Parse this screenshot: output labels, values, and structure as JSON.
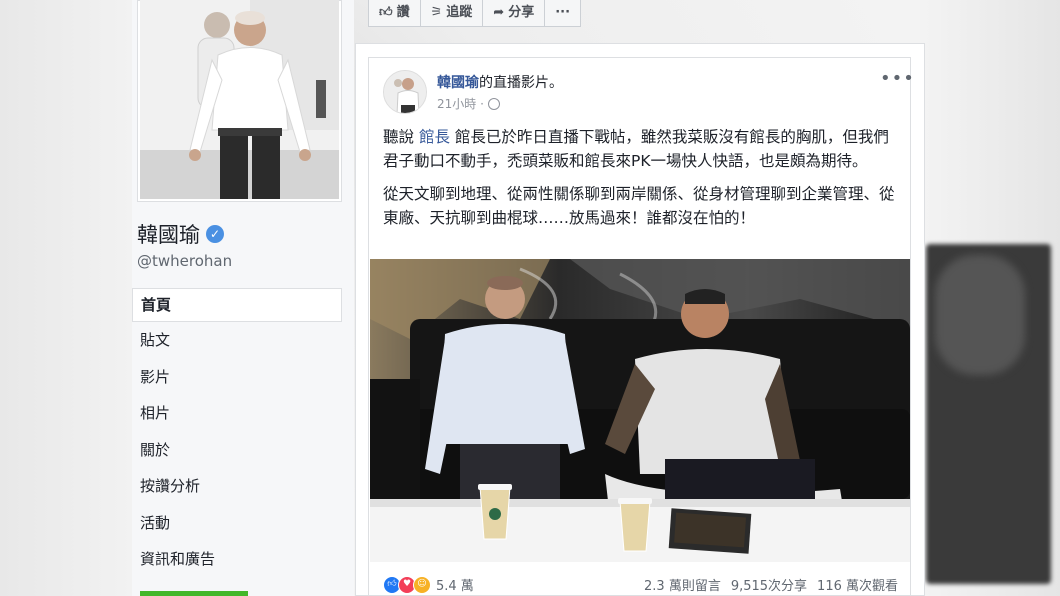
{
  "action_bar": {
    "like": "讚",
    "follow": "追蹤",
    "share": "分享",
    "more": "···"
  },
  "profile": {
    "name": "韓國瑜",
    "handle": "@twherohan",
    "nav": [
      {
        "label": "首頁"
      },
      {
        "label": "貼文"
      },
      {
        "label": "影片"
      },
      {
        "label": "相片"
      },
      {
        "label": "關於"
      },
      {
        "label": "按讚分析"
      },
      {
        "label": "活動"
      },
      {
        "label": "資訊和廣告"
      }
    ]
  },
  "post": {
    "author": "韓國瑜",
    "author_suffix": "的直播影片。",
    "time": "21小時 ·",
    "more": "•••",
    "paragraph1_a": "聽說 ",
    "paragraph1_mention": "館長",
    "paragraph1_b": " 館長已於昨日直播下戰帖，雖然我菜販沒有館長的胸肌，但我們君子動口不動手，禿頭菜販和館長來PK一場快人快語，也是頗為期待。",
    "paragraph2": "從天文聊到地理、從兩性關係聊到兩岸關係、從身材管理聊到企業管理、從東廠、天抗聊到曲棍球……放馬過來！誰都沒在怕的！",
    "reactions_count": "5.4 萬",
    "comments": "2.3 萬則留言",
    "shares": "9,515次分享",
    "views": "116 萬次觀看"
  },
  "colors": {
    "link": "#365899",
    "verified": "#4a90e2",
    "like": "#2078f4",
    "love": "#f33e58",
    "haha": "#f7b125"
  }
}
